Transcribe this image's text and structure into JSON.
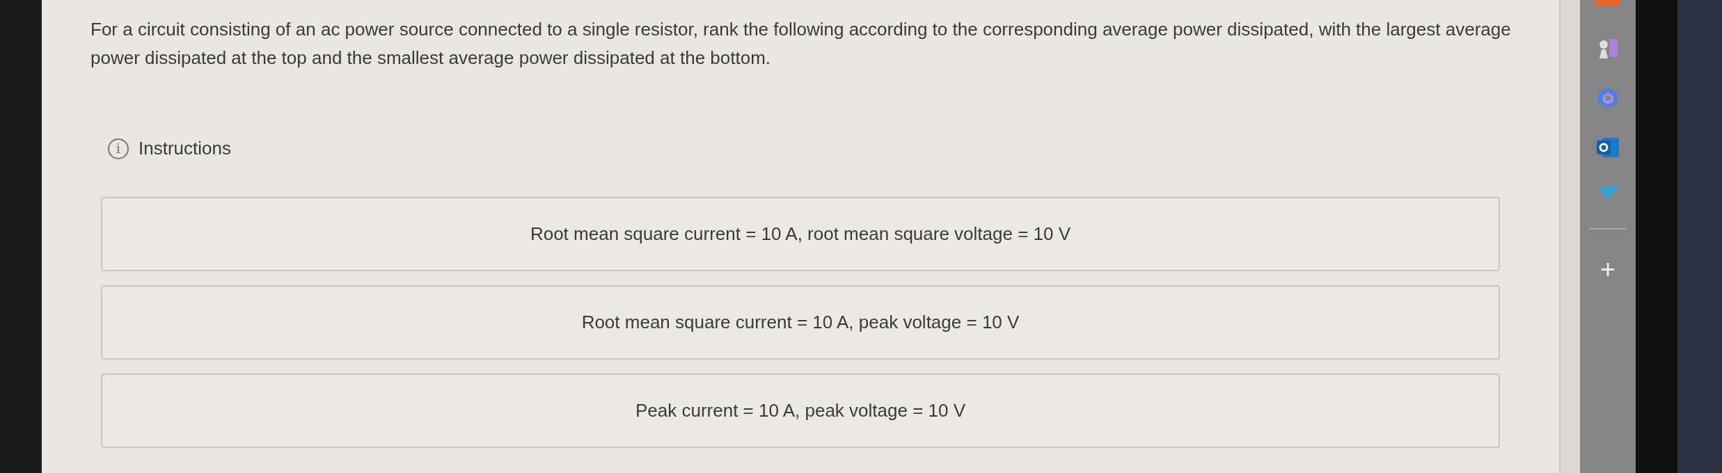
{
  "question": "For a circuit consisting of an ac power source connected to a single resistor, rank the following according to the corresponding average power dissipated, with the largest average power dissipated at the top and the smallest average power dissipated at the bottom.",
  "instructions": {
    "info_glyph": "i",
    "label": "Instructions"
  },
  "ranking_items": [
    {
      "text": "Root mean square current = 10 A, root mean square voltage = 10 V"
    },
    {
      "text": "Root mean square current = 10 A, peak voltage = 10 V"
    },
    {
      "text": "Peak current = 10 A, peak voltage = 10 V"
    }
  ],
  "sidebar": {
    "add_glyph": "+"
  }
}
